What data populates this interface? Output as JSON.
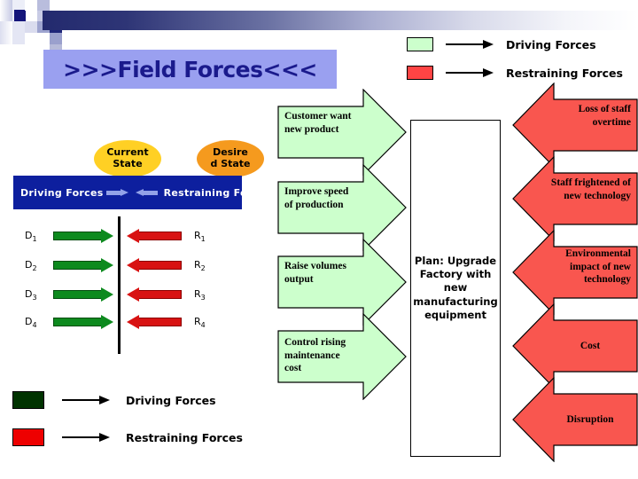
{
  "slide": {
    "title": ">>>Field Forces<<<",
    "title_bg": "#9aa0f0",
    "title_color": "#1a1a8c"
  },
  "legend_top": {
    "items": [
      {
        "label": "Driving Forces",
        "color": "#ccffcc",
        "icon": "arrow-right-icon"
      },
      {
        "label": "Restraining Forces",
        "color": "#ff4444",
        "icon": "arrow-right-icon"
      }
    ]
  },
  "legend_bottom": {
    "items": [
      {
        "label": "Driving Forces",
        "color": "#003300",
        "icon": "arrow-right-icon"
      },
      {
        "label": "Restraining Forces",
        "color": "#ee0000",
        "icon": "arrow-right-icon"
      }
    ]
  },
  "force_field": {
    "current_state": "Current\nState",
    "current_state_line1": "Current",
    "current_state_line2": "State",
    "desired_state_line1": "Desire",
    "desired_state_line2": "d State",
    "banner_left": "Driving  Forces",
    "banner_right": "Restraining  Forces",
    "driving": [
      {
        "label": "D",
        "sub": "1"
      },
      {
        "label": "D",
        "sub": "2"
      },
      {
        "label": "D",
        "sub": "3"
      },
      {
        "label": "D",
        "sub": "4"
      }
    ],
    "restraining": [
      {
        "label": "R",
        "sub": "1"
      },
      {
        "label": "R",
        "sub": "2"
      },
      {
        "label": "R",
        "sub": "3"
      },
      {
        "label": "R",
        "sub": "4"
      }
    ]
  },
  "driving_arrows": [
    {
      "lines": [
        "Customer want",
        "new product"
      ]
    },
    {
      "lines": [
        "Improve speed",
        "of production"
      ]
    },
    {
      "lines": [
        "Raise volumes",
        "output"
      ]
    },
    {
      "lines": [
        "Control rising",
        "maintenance",
        "cost"
      ]
    }
  ],
  "restraining_arrows": [
    {
      "lines": [
        "Loss of staff",
        "overtime"
      ]
    },
    {
      "lines": [
        "Staff frightened of",
        "new technology"
      ]
    },
    {
      "lines": [
        "Environmental",
        "impact of new",
        "technology"
      ]
    },
    {
      "lines": [
        "Cost"
      ]
    },
    {
      "lines": [
        "Disruption"
      ]
    }
  ],
  "plan": {
    "lines": [
      "Plan: Upgrade",
      "Factory with",
      "new",
      "manufacturing",
      "equipment"
    ]
  },
  "colors": {
    "green_fill": "#ccffcc",
    "red_fill": "#f9564f",
    "dark_green": "#003300",
    "bright_red": "#ee0000",
    "navy": "#0d1f9e",
    "yellow": "#ffd024",
    "orange": "#f59a1e"
  }
}
